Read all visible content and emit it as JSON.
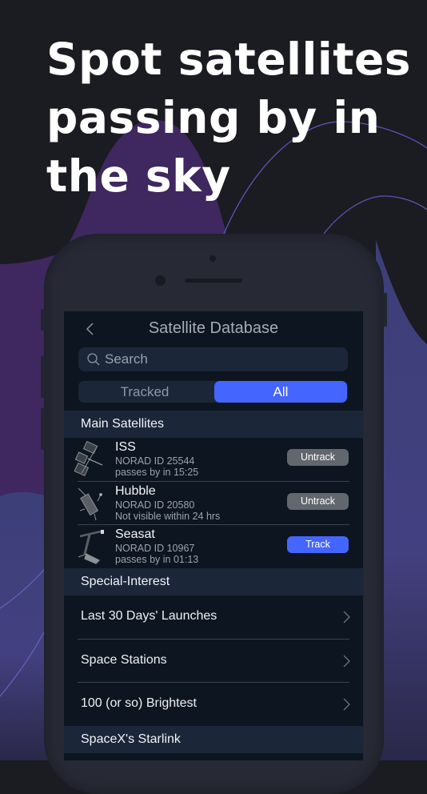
{
  "headline": {
    "lines": [
      "Spot satellites",
      "passing by in",
      "the sky"
    ]
  },
  "app": {
    "nav": {
      "title": "Satellite Database",
      "back_icon": "chevron-left-icon"
    },
    "search": {
      "placeholder": "Search",
      "icon": "search-icon"
    },
    "segmented": {
      "options": [
        "Tracked",
        "All"
      ],
      "selected": "All"
    },
    "sections": [
      {
        "title": "Main Satellites",
        "satellites": [
          {
            "name": "ISS",
            "norad": "NORAD ID 25544",
            "status": "passes by in 15:25",
            "action": "Untrack",
            "tracked": true
          },
          {
            "name": "Hubble",
            "norad": "NORAD ID 20580",
            "status": "Not visible within 24 hrs",
            "action": "Untrack",
            "tracked": true
          },
          {
            "name": "Seasat",
            "norad": "NORAD ID 10967",
            "status": "passes by in 01:13",
            "action": "Track",
            "tracked": false
          }
        ]
      },
      {
        "title": "Special-Interest",
        "items": [
          "Last 30 Days' Launches",
          "Space Stations",
          "100 (or so) Brightest"
        ]
      },
      {
        "title": "SpaceX's Starlink"
      }
    ]
  },
  "colors": {
    "accent": "#4466ff",
    "untrack_button": "#62666d",
    "background": "#1b1b22",
    "purple_shape": "#3f2760",
    "screen_bg": "#0d1620",
    "section_header_bg": "#1b2639"
  }
}
